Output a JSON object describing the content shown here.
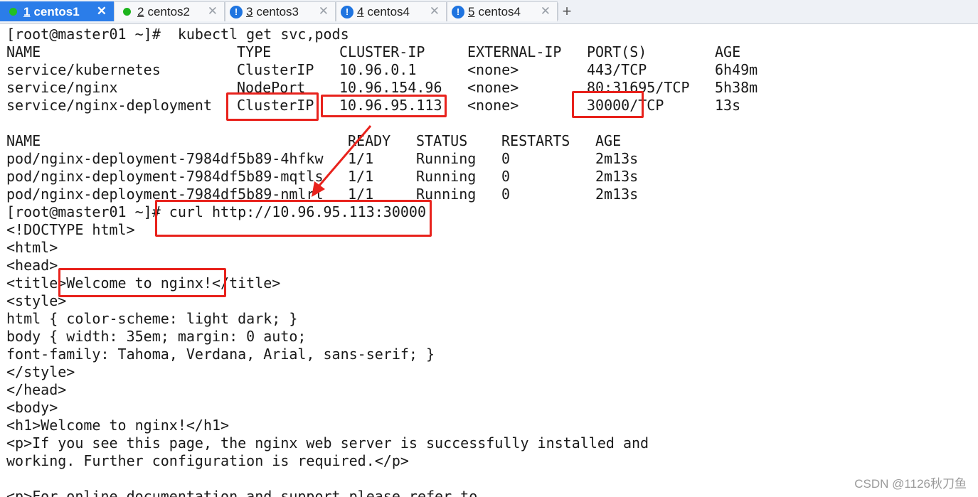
{
  "tabs": [
    {
      "num": "1",
      "title": "centos1",
      "status": "connected",
      "active": true
    },
    {
      "num": "2",
      "title": "centos2",
      "status": "connected"
    },
    {
      "num": "3",
      "title": "centos3",
      "status": "warning"
    },
    {
      "num": "4",
      "title": "centos4",
      "status": "warning"
    },
    {
      "num": "5",
      "title": "centos4",
      "status": "warning"
    }
  ],
  "icons": {
    "close": "close-icon",
    "add": "plus-icon",
    "connected": "green-dot-icon",
    "warning": "exclamation-icon"
  },
  "colors": {
    "active_tab": "#2b7de9",
    "highlight": "#e8221c",
    "connected": "#1db41d",
    "warning": "#1f74e0"
  },
  "terminal": {
    "prompt1": "[root@master01 ~]#  kubectl get svc,pods",
    "svc_header": [
      "NAME",
      "TYPE",
      "CLUSTER-IP",
      "EXTERNAL-IP",
      "PORT(S)",
      "AGE"
    ],
    "svc_rows": [
      [
        "service/kubernetes",
        "ClusterIP",
        "10.96.0.1",
        "<none>",
        "443/TCP",
        "6h49m"
      ],
      [
        "service/nginx",
        "NodePort",
        "10.96.154.96",
        "<none>",
        "80:31695/TCP",
        "5h38m"
      ],
      [
        "service/nginx-deployment",
        "ClusterIP",
        "10.96.95.113",
        "<none>",
        "30000/TCP",
        "13s"
      ]
    ],
    "pod_header": [
      "NAME",
      "READY",
      "STATUS",
      "RESTARTS",
      "AGE"
    ],
    "pod_rows": [
      [
        "pod/nginx-deployment-7984df5b89-4hfkw",
        "1/1",
        "Running",
        "0",
        "2m13s"
      ],
      [
        "pod/nginx-deployment-7984df5b89-mqtls",
        "1/1",
        "Running",
        "0",
        "2m13s"
      ],
      [
        "pod/nginx-deployment-7984df5b89-nmlrl",
        "1/1",
        "Running",
        "0",
        "2m13s"
      ]
    ],
    "prompt2": "[root@master01 ~]# curl http://10.96.95.113:30000",
    "output": [
      "<!DOCTYPE html>",
      "<html>",
      "<head>",
      "<title>Welcome to nginx!</title>",
      "<style>",
      "html { color-scheme: light dark; }",
      "body { width: 35em; margin: 0 auto;",
      "font-family: Tahoma, Verdana, Arial, sans-serif; }",
      "</style>",
      "</head>",
      "<body>",
      "<h1>Welcome to nginx!</h1>",
      "<p>If you see this page, the nginx web server is successfully installed and",
      "working. Further configuration is required.</p>",
      "",
      "<p>For online documentation and support please refer to"
    ]
  },
  "watermark": "CSDN @1126秋刀鱼"
}
